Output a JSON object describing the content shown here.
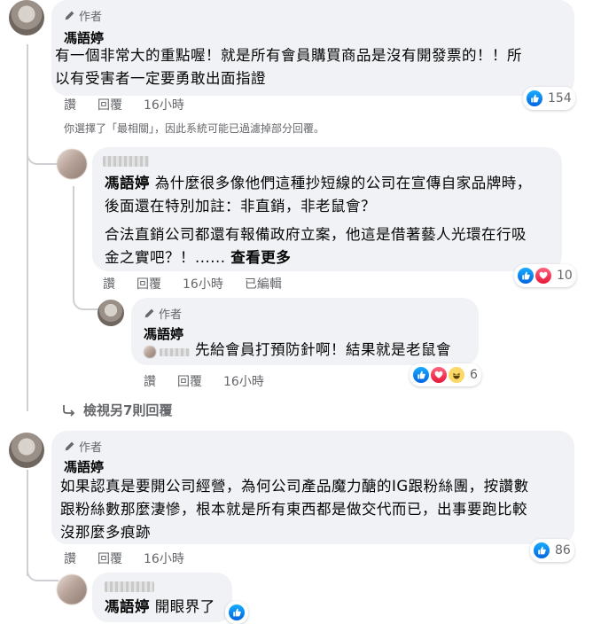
{
  "comments": [
    {
      "badge": "作者",
      "name": "馮語婷",
      "text_lines": [
        "有一個非常大的重點喔！就是所有會員購買商品是沒有開發票的！！所",
        "以有受害者一定要勇敢出面指證"
      ],
      "actions": [
        "讚",
        "回覆",
        "16小時"
      ],
      "reactions": "154"
    }
  ],
  "filter_note": "你選擇了「最相關」，因此系統可能已過濾掉部分回覆。",
  "reply1": {
    "mention": "馮語婷",
    "line1": " 為什麼很多像他們這種抄短線的公司在宣傳自家品牌時，",
    "line2": "後面還在特別加註：非直銷，非老鼠會？",
    "line3": "合法直銷公司都還有報備政府立案，他這是借著藝人光環在行吸",
    "line4": "金之實吧？！......",
    "see_more": "查看更多",
    "actions": [
      "讚",
      "回覆",
      "16小時",
      "已編輯"
    ],
    "reactions": "10"
  },
  "reply2": {
    "badge": "作者",
    "name": "馮語婷",
    "text": "先給會員打預防針啊！結果就是老鼠會",
    "actions": [
      "讚",
      "回覆",
      "16小時"
    ],
    "reactions": "6"
  },
  "view_more": "檢視另7則回覆",
  "comment2": {
    "badge": "作者",
    "name": "馮語婷",
    "line1": "如果認真是要開公司經營，為何公司產品魔力醣的IG跟粉絲團，按讚數",
    "line2": "跟粉絲數那麼淒慘，根本就是所有東西都是做交代而已，出事要跑比較",
    "line3": "沒那麼多痕跡",
    "actions": [
      "讚",
      "回覆",
      "16小時"
    ],
    "reactions": "86"
  },
  "reply3": {
    "mention": "馮語婷",
    "text": " 開眼界了"
  },
  "colors": {
    "bubble": "#f0f2f5",
    "secondary_text": "#65676b",
    "like_blue": "#0866ff",
    "love_red": "#e61739",
    "haha_yellow": "#fcd868"
  },
  "icons": [
    "pencil-icon",
    "like-icon",
    "love-icon",
    "haha-icon",
    "reply-arrow-icon"
  ]
}
